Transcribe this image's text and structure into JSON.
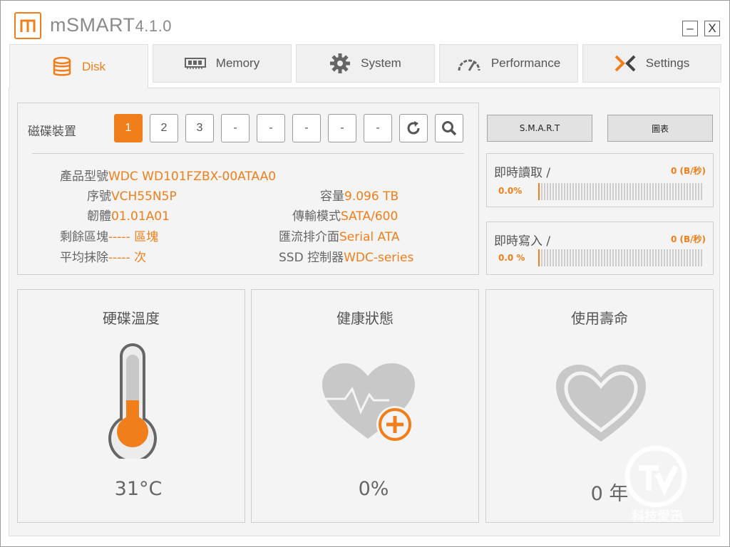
{
  "app": {
    "name": "mSMART",
    "version": "4.1.0",
    "logo_letter": "m",
    "minimize_glyph": "–",
    "close_glyph": "X"
  },
  "tabs": [
    {
      "label": "Disk",
      "icon": "database-icon",
      "active": true
    },
    {
      "label": "Memory",
      "icon": "memory-chip-icon",
      "active": false
    },
    {
      "label": "System",
      "icon": "gear-icon",
      "active": false
    },
    {
      "label": "Performance",
      "icon": "speedometer-icon",
      "active": false
    },
    {
      "label": "Settings",
      "icon": "settings-x-icon",
      "active": false
    }
  ],
  "device": {
    "label": "磁碟裝置",
    "buttons": [
      "1",
      "2",
      "3",
      "-",
      "-",
      "-",
      "-",
      "-"
    ],
    "selected": "1",
    "refresh_icon": "refresh-icon",
    "search_icon": "search-icon"
  },
  "info": {
    "model": {
      "label": "產品型號",
      "value": "WDC WD101FZBX-00ATAA0"
    },
    "serial": {
      "label": "序號",
      "value": "VCH55N5P"
    },
    "capacity": {
      "label": "容量",
      "value": "9.096 TB"
    },
    "firmware": {
      "label": "韌體",
      "value": "01.01A01"
    },
    "transfer": {
      "label": "傳輸模式",
      "value": "SATA/600"
    },
    "spare": {
      "label": "剩餘區塊",
      "value": "----- 區塊"
    },
    "interface": {
      "label": "匯流排介面",
      "value": "Serial ATA"
    },
    "wear": {
      "label": "平均抹除",
      "value": "----- 次"
    },
    "controller": {
      "label": "SSD 控制器",
      "value": "WDC-series"
    }
  },
  "buttons": {
    "smart": "S.M.A.R.T",
    "chart": "圖表"
  },
  "io": {
    "read": {
      "title": "即時讀取 /",
      "rate": "0 (B/秒)",
      "percent": "0.0%",
      "level": 0
    },
    "write": {
      "title": "即時寫入 /",
      "rate": "0 (B/秒)",
      "percent": "0.0 %",
      "level": 0
    }
  },
  "cards": {
    "temperature": {
      "title": "硬碟溫度",
      "value": "31°C",
      "icon": "thermometer-icon"
    },
    "health": {
      "title": "健康狀態",
      "value": "0%",
      "icon": "heart-health-icon"
    },
    "life": {
      "title": "使用壽命",
      "value": "0 年",
      "icon": "heart-icon"
    }
  },
  "watermark": {
    "text": "科技愛迅",
    "icon": "watermark-logo-icon"
  },
  "colors": {
    "accent": "#f07e1a",
    "panel": "#f4f4f4",
    "border": "#cfcfcf",
    "icon_gray": "#c8c8c8"
  }
}
